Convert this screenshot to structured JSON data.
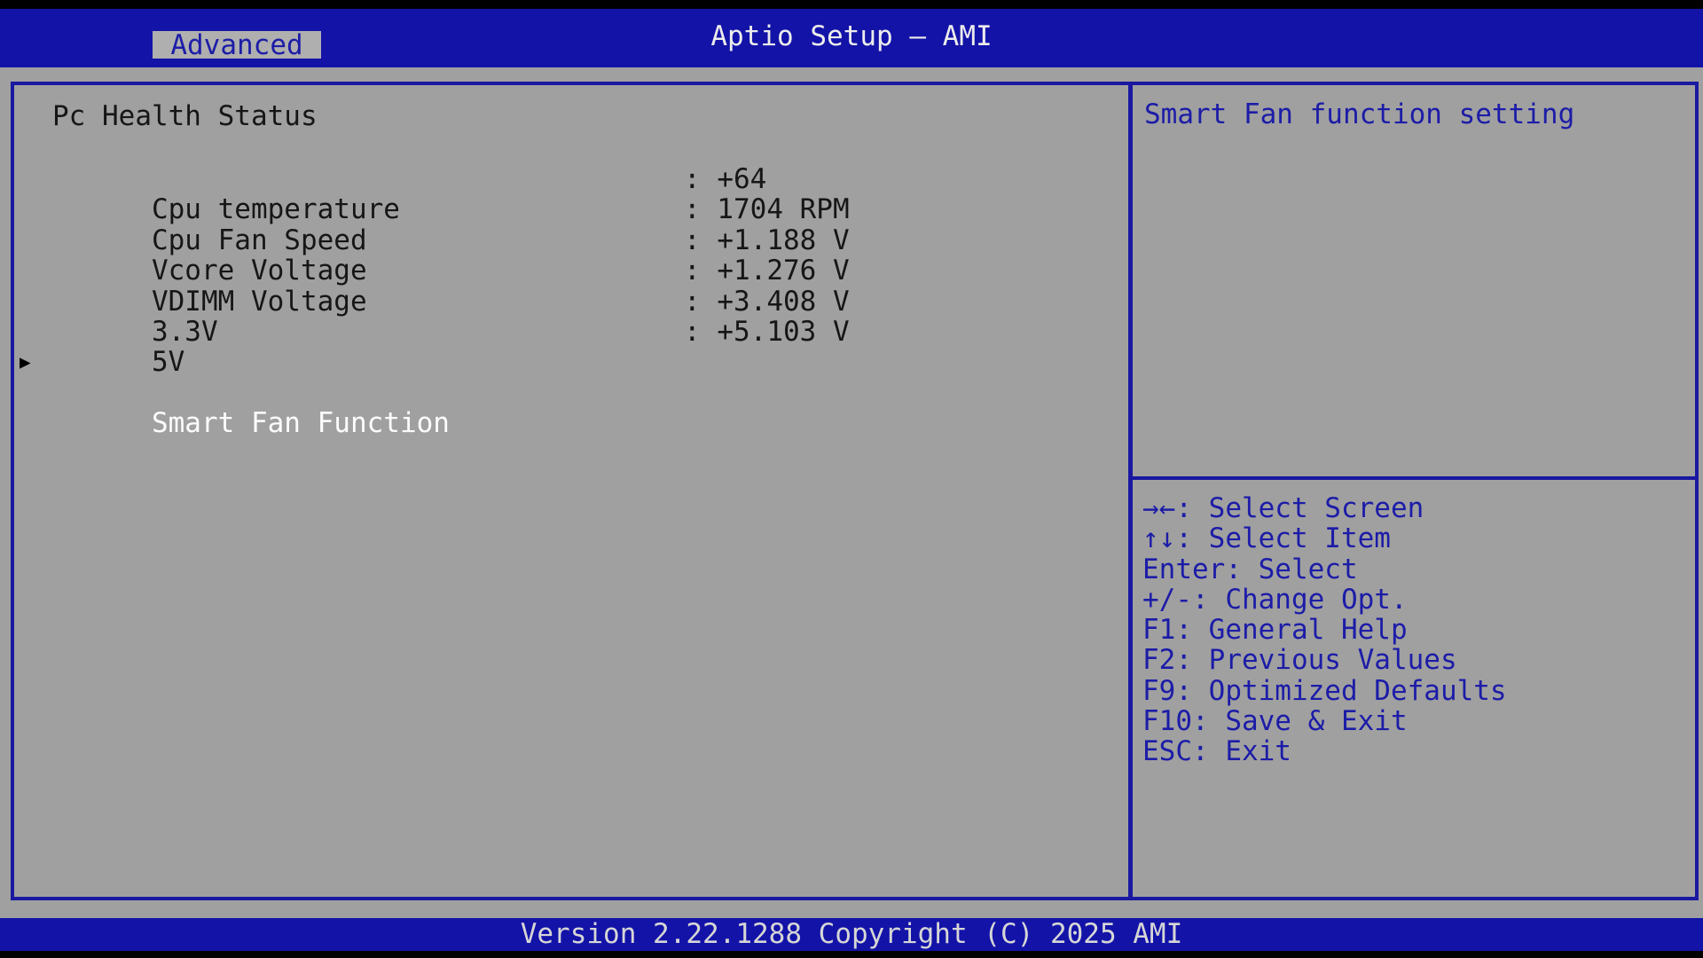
{
  "app": {
    "title": "Aptio Setup — AMI",
    "version_bar": "Version 2.22.1288 Copyright (C) 2025 AMI"
  },
  "tabs": [
    {
      "label": "Advanced",
      "active": true
    }
  ],
  "main": {
    "section_title": "Pc Health Status",
    "separator": ": ",
    "sensors": [
      {
        "label": "Cpu temperature",
        "value": "+64"
      },
      {
        "label": "Cpu Fan Speed",
        "value": "1704 RPM"
      },
      {
        "label": "Vcore Voltage",
        "value": "+1.188 V"
      },
      {
        "label": "VDIMM Voltage",
        "value": "+1.276 V"
      },
      {
        "label": "3.3V",
        "value": "+3.408 V"
      },
      {
        "label": "5V",
        "value": "+5.103 V"
      }
    ],
    "submenu": {
      "label": "Smart Fan Function",
      "selected": true
    }
  },
  "help": {
    "description": "Smart Fan function setting",
    "keys": [
      "→←: Select Screen",
      "↑↓: Select Item",
      "Enter: Select",
      "+/-: Change Opt.",
      "F1: General Help",
      "F2: Previous Values",
      "F9: Optimized Defaults",
      "F10: Save & Exit",
      "ESC: Exit"
    ]
  },
  "icons": {
    "submenu_arrow": "▶"
  },
  "colors": {
    "header_blue": "#1313A8",
    "border_navy": "#1A18A0",
    "text_navy": "#1C1CA8",
    "background_gray": "#A0A0A0",
    "label_dark": "#161616",
    "selected_white": "#FCFCFC",
    "title_white": "#ECECEC"
  }
}
